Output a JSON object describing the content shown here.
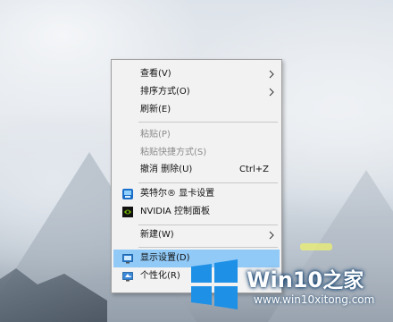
{
  "context_menu": {
    "items": [
      {
        "label": "查看(V)",
        "has_submenu": true,
        "enabled": true
      },
      {
        "label": "排序方式(O)",
        "has_submenu": true,
        "enabled": true
      },
      {
        "label": "刷新(E)",
        "enabled": true
      },
      {
        "label": "粘贴(P)",
        "enabled": false
      },
      {
        "label": "粘贴快捷方式(S)",
        "enabled": false
      },
      {
        "label": "撤消 删除(U)",
        "shortcut": "Ctrl+Z",
        "enabled": true
      },
      {
        "label": "英特尔® 显卡设置",
        "icon": "intel-graphics-icon",
        "enabled": true
      },
      {
        "label": "NVIDIA 控制面板",
        "icon": "nvidia-icon",
        "enabled": true
      },
      {
        "label": "新建(W)",
        "has_submenu": true,
        "enabled": true
      },
      {
        "label": "显示设置(D)",
        "icon": "display-settings-icon",
        "enabled": true,
        "highlighted": true
      },
      {
        "label": "个性化(R)",
        "icon": "personalize-icon",
        "enabled": true
      }
    ]
  },
  "watermark": {
    "brand": "Win10",
    "brand_suffix": "之家",
    "url": "www.win10xitong.com"
  },
  "colors": {
    "menu_bg": "#f2f2f2",
    "highlight": "#91c9f7",
    "windows_blue": "#1e90e6"
  }
}
